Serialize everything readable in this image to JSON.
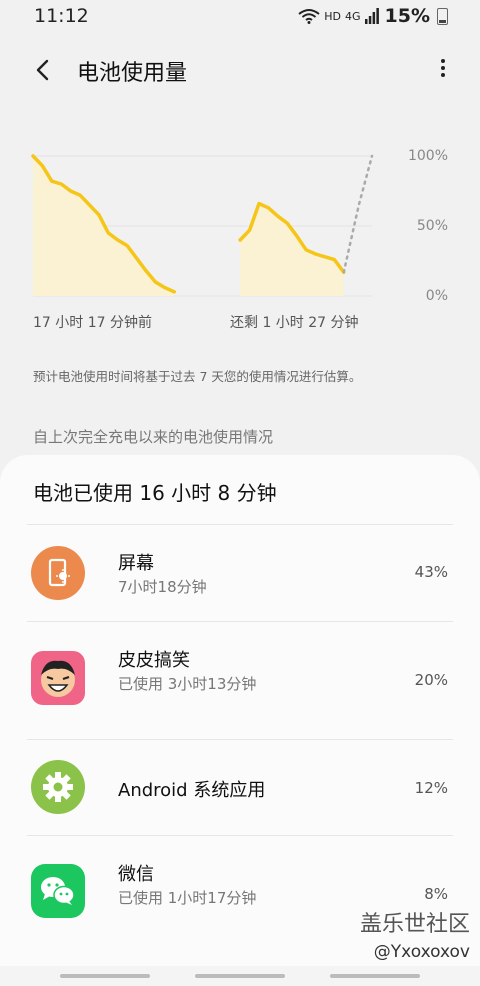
{
  "status": {
    "time": "11:12",
    "network_labels": [
      "HD",
      "4G"
    ],
    "battery_percent": "15%"
  },
  "header": {
    "title": "电池使用量"
  },
  "chart_data": {
    "type": "area",
    "y_ticks": [
      "100%",
      "50%",
      "0%"
    ],
    "ylim": [
      0,
      100
    ],
    "x_labels": [
      "17 小时 17 分钟前",
      "还剩 1 小时 27 分钟"
    ],
    "series": [
      {
        "values": [
          [
            0,
            100
          ],
          [
            0.5,
            93
          ],
          [
            1,
            82
          ],
          [
            1.5,
            80
          ],
          [
            2,
            75
          ],
          [
            2.5,
            72
          ],
          [
            3,
            65
          ],
          [
            3.5,
            58
          ],
          [
            4,
            45
          ],
          [
            4.5,
            40
          ],
          [
            5,
            36
          ],
          [
            5.5,
            27
          ],
          [
            6,
            18
          ],
          [
            6.5,
            10
          ],
          [
            7,
            6
          ],
          [
            7.5,
            3
          ]
        ]
      },
      {
        "values": [
          [
            11,
            40
          ],
          [
            11.5,
            47
          ],
          [
            12,
            66
          ],
          [
            12.5,
            63
          ],
          [
            13,
            57
          ],
          [
            13.5,
            52
          ],
          [
            14,
            43
          ],
          [
            14.5,
            33
          ],
          [
            15,
            30
          ],
          [
            15.5,
            28
          ],
          [
            16,
            26
          ],
          [
            16.5,
            17
          ]
        ]
      }
    ],
    "projection": [
      [
        16.5,
        17
      ],
      [
        17.3,
        65
      ],
      [
        18,
        100
      ]
    ],
    "colors": {
      "line": "#F5C518",
      "fill": "#FBF1D3",
      "projection": "#AAAAAA",
      "grid": "#E2E2E2"
    }
  },
  "estimate_note": "预计电池使用时间将基于过去 7 天您的使用情况进行估算。",
  "section_label": "自上次完全充电以来的电池使用情况",
  "usage": {
    "title": "电池已使用 16 小时 8 分钟",
    "apps": [
      {
        "name": "屏幕",
        "detail": "7小时18分钟",
        "percent": "43%",
        "icon": "screen-icon",
        "color": "#EC8A4E"
      },
      {
        "name": "皮皮搞笑",
        "detail": "已使用 3小时13分钟",
        "percent": "20%",
        "icon": "pipigaoxiao-icon",
        "color": "#F06488"
      },
      {
        "name": "Android 系统应用",
        "detail": "",
        "percent": "12%",
        "icon": "gear-icon",
        "color": "#8BC34A"
      },
      {
        "name": "微信",
        "detail": "已使用 1小时17分钟",
        "percent": "8%",
        "icon": "wechat-icon",
        "color": "#1DC760"
      }
    ]
  },
  "watermark": {
    "line1": "盖乐世社区",
    "line2": "@Yxoxoxov"
  }
}
